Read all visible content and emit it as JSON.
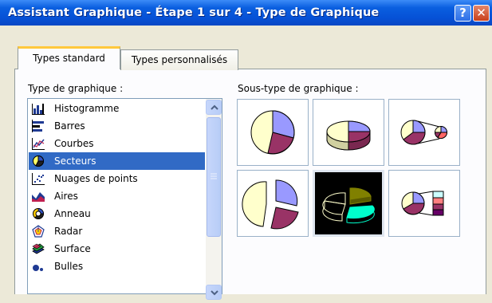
{
  "window": {
    "title": "Assistant Graphique - Étape 1 sur 4 - Type de Graphique",
    "help_glyph": "?",
    "close_glyph": "✕"
  },
  "tabs": [
    {
      "label": "Types standard",
      "active": true
    },
    {
      "label": "Types personnalisés",
      "active": false
    }
  ],
  "chart_type": {
    "label": "Type de graphique :",
    "items": [
      {
        "label": "Histogramme",
        "icon": "column-chart-icon",
        "selected": false
      },
      {
        "label": "Barres",
        "icon": "bar-chart-icon",
        "selected": false
      },
      {
        "label": "Courbes",
        "icon": "line-chart-icon",
        "selected": false
      },
      {
        "label": "Secteurs",
        "icon": "pie-chart-icon",
        "selected": true
      },
      {
        "label": "Nuages de points",
        "icon": "scatter-chart-icon",
        "selected": false
      },
      {
        "label": "Aires",
        "icon": "area-chart-icon",
        "selected": false
      },
      {
        "label": "Anneau",
        "icon": "doughnut-chart-icon",
        "selected": false
      },
      {
        "label": "Radar",
        "icon": "radar-chart-icon",
        "selected": false
      },
      {
        "label": "Surface",
        "icon": "surface-chart-icon",
        "selected": false
      },
      {
        "label": "Bulles",
        "icon": "bubble-chart-icon",
        "selected": false
      }
    ]
  },
  "subtype": {
    "label": "Sous-type de graphique :",
    "items": [
      {
        "name": "pie",
        "selected": false
      },
      {
        "name": "pie-3d",
        "selected": false
      },
      {
        "name": "pie-of-pie",
        "selected": false
      },
      {
        "name": "exploded-pie",
        "selected": false
      },
      {
        "name": "exploded-pie-3d",
        "selected": true
      },
      {
        "name": "bar-of-pie",
        "selected": false
      }
    ]
  },
  "colors": {
    "titlebar": "#0651d6",
    "selection": "#316ac5",
    "pie_lavender": "#9999ff",
    "pie_plum": "#993366",
    "pie_cream": "#ffffcc",
    "pie_olive": "#808000",
    "pie_teal": "#00ffcc"
  }
}
